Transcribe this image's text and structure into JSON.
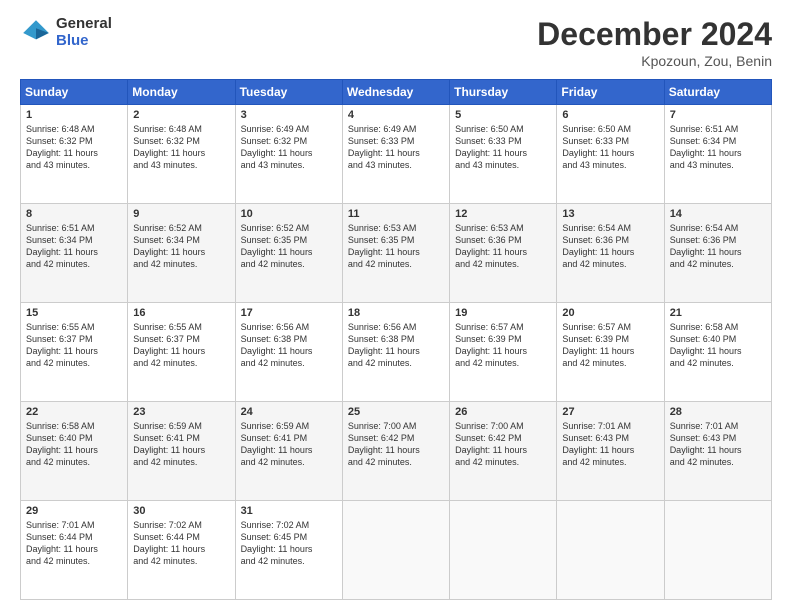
{
  "logo": {
    "general": "General",
    "blue": "Blue"
  },
  "title": "December 2024",
  "location": "Kpozoun, Zou, Benin",
  "weekdays": [
    "Sunday",
    "Monday",
    "Tuesday",
    "Wednesday",
    "Thursday",
    "Friday",
    "Saturday"
  ],
  "weeks": [
    [
      {
        "day": "1",
        "info": "Sunrise: 6:48 AM\nSunset: 6:32 PM\nDaylight: 11 hours\nand 43 minutes."
      },
      {
        "day": "2",
        "info": "Sunrise: 6:48 AM\nSunset: 6:32 PM\nDaylight: 11 hours\nand 43 minutes."
      },
      {
        "day": "3",
        "info": "Sunrise: 6:49 AM\nSunset: 6:32 PM\nDaylight: 11 hours\nand 43 minutes."
      },
      {
        "day": "4",
        "info": "Sunrise: 6:49 AM\nSunset: 6:33 PM\nDaylight: 11 hours\nand 43 minutes."
      },
      {
        "day": "5",
        "info": "Sunrise: 6:50 AM\nSunset: 6:33 PM\nDaylight: 11 hours\nand 43 minutes."
      },
      {
        "day": "6",
        "info": "Sunrise: 6:50 AM\nSunset: 6:33 PM\nDaylight: 11 hours\nand 43 minutes."
      },
      {
        "day": "7",
        "info": "Sunrise: 6:51 AM\nSunset: 6:34 PM\nDaylight: 11 hours\nand 43 minutes."
      }
    ],
    [
      {
        "day": "8",
        "info": "Sunrise: 6:51 AM\nSunset: 6:34 PM\nDaylight: 11 hours\nand 42 minutes."
      },
      {
        "day": "9",
        "info": "Sunrise: 6:52 AM\nSunset: 6:34 PM\nDaylight: 11 hours\nand 42 minutes."
      },
      {
        "day": "10",
        "info": "Sunrise: 6:52 AM\nSunset: 6:35 PM\nDaylight: 11 hours\nand 42 minutes."
      },
      {
        "day": "11",
        "info": "Sunrise: 6:53 AM\nSunset: 6:35 PM\nDaylight: 11 hours\nand 42 minutes."
      },
      {
        "day": "12",
        "info": "Sunrise: 6:53 AM\nSunset: 6:36 PM\nDaylight: 11 hours\nand 42 minutes."
      },
      {
        "day": "13",
        "info": "Sunrise: 6:54 AM\nSunset: 6:36 PM\nDaylight: 11 hours\nand 42 minutes."
      },
      {
        "day": "14",
        "info": "Sunrise: 6:54 AM\nSunset: 6:36 PM\nDaylight: 11 hours\nand 42 minutes."
      }
    ],
    [
      {
        "day": "15",
        "info": "Sunrise: 6:55 AM\nSunset: 6:37 PM\nDaylight: 11 hours\nand 42 minutes."
      },
      {
        "day": "16",
        "info": "Sunrise: 6:55 AM\nSunset: 6:37 PM\nDaylight: 11 hours\nand 42 minutes."
      },
      {
        "day": "17",
        "info": "Sunrise: 6:56 AM\nSunset: 6:38 PM\nDaylight: 11 hours\nand 42 minutes."
      },
      {
        "day": "18",
        "info": "Sunrise: 6:56 AM\nSunset: 6:38 PM\nDaylight: 11 hours\nand 42 minutes."
      },
      {
        "day": "19",
        "info": "Sunrise: 6:57 AM\nSunset: 6:39 PM\nDaylight: 11 hours\nand 42 minutes."
      },
      {
        "day": "20",
        "info": "Sunrise: 6:57 AM\nSunset: 6:39 PM\nDaylight: 11 hours\nand 42 minutes."
      },
      {
        "day": "21",
        "info": "Sunrise: 6:58 AM\nSunset: 6:40 PM\nDaylight: 11 hours\nand 42 minutes."
      }
    ],
    [
      {
        "day": "22",
        "info": "Sunrise: 6:58 AM\nSunset: 6:40 PM\nDaylight: 11 hours\nand 42 minutes."
      },
      {
        "day": "23",
        "info": "Sunrise: 6:59 AM\nSunset: 6:41 PM\nDaylight: 11 hours\nand 42 minutes."
      },
      {
        "day": "24",
        "info": "Sunrise: 6:59 AM\nSunset: 6:41 PM\nDaylight: 11 hours\nand 42 minutes."
      },
      {
        "day": "25",
        "info": "Sunrise: 7:00 AM\nSunset: 6:42 PM\nDaylight: 11 hours\nand 42 minutes."
      },
      {
        "day": "26",
        "info": "Sunrise: 7:00 AM\nSunset: 6:42 PM\nDaylight: 11 hours\nand 42 minutes."
      },
      {
        "day": "27",
        "info": "Sunrise: 7:01 AM\nSunset: 6:43 PM\nDaylight: 11 hours\nand 42 minutes."
      },
      {
        "day": "28",
        "info": "Sunrise: 7:01 AM\nSunset: 6:43 PM\nDaylight: 11 hours\nand 42 minutes."
      }
    ],
    [
      {
        "day": "29",
        "info": "Sunrise: 7:01 AM\nSunset: 6:44 PM\nDaylight: 11 hours\nand 42 minutes."
      },
      {
        "day": "30",
        "info": "Sunrise: 7:02 AM\nSunset: 6:44 PM\nDaylight: 11 hours\nand 42 minutes."
      },
      {
        "day": "31",
        "info": "Sunrise: 7:02 AM\nSunset: 6:45 PM\nDaylight: 11 hours\nand 42 minutes."
      },
      {
        "day": "",
        "info": ""
      },
      {
        "day": "",
        "info": ""
      },
      {
        "day": "",
        "info": ""
      },
      {
        "day": "",
        "info": ""
      }
    ]
  ]
}
